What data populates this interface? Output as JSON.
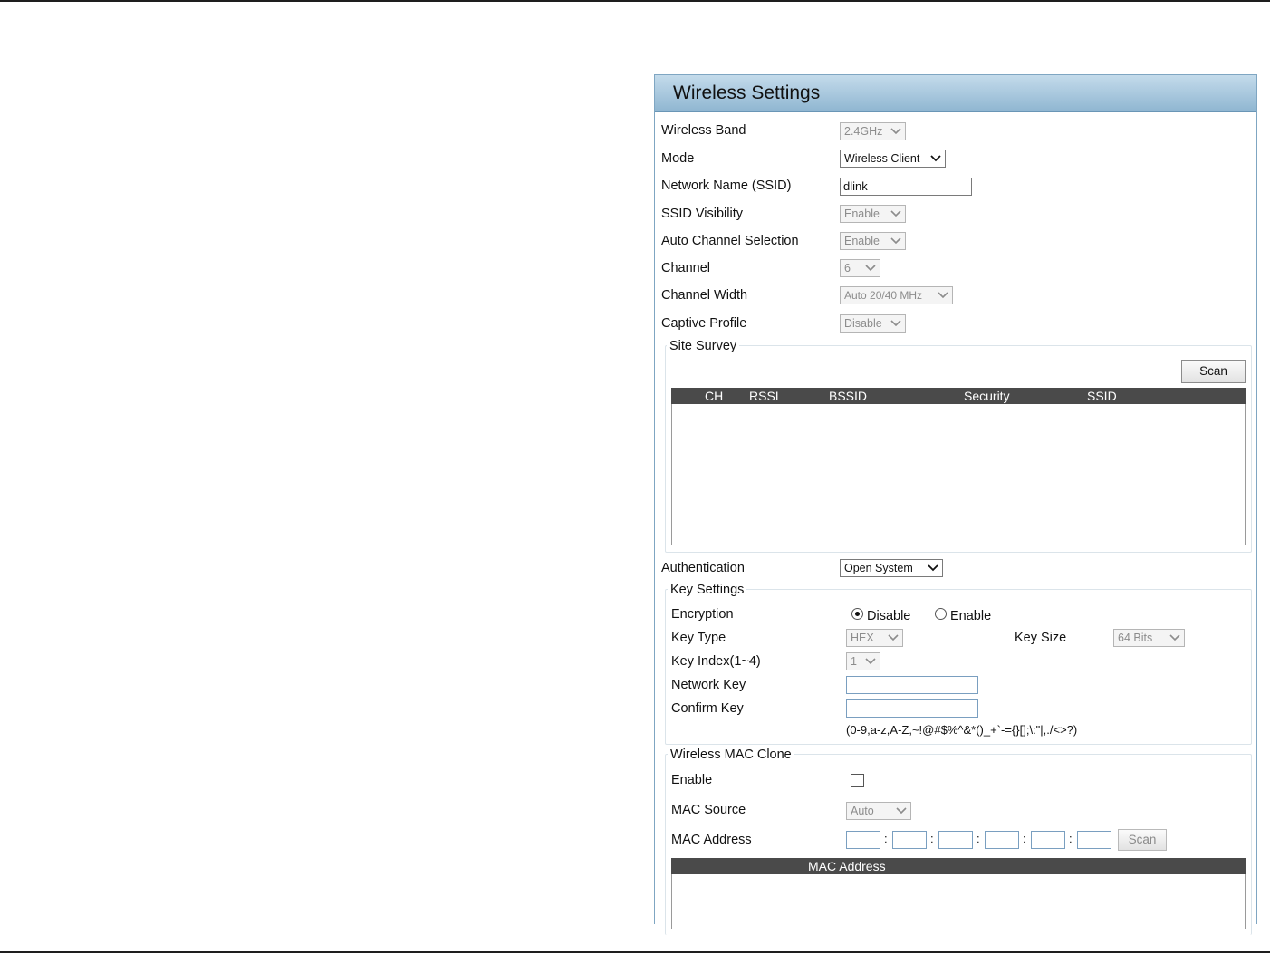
{
  "panel": {
    "title": "Wireless Settings"
  },
  "fields": {
    "wireless_band": {
      "label": "Wireless Band",
      "value": "2.4GHz"
    },
    "mode": {
      "label": "Mode",
      "value": "Wireless Client"
    },
    "ssid": {
      "label": "Network Name (SSID)",
      "value": "dlink"
    },
    "ssid_visibility": {
      "label": "SSID Visibility",
      "value": "Enable"
    },
    "auto_channel": {
      "label": "Auto Channel Selection",
      "value": "Enable"
    },
    "channel": {
      "label": "Channel",
      "value": "6"
    },
    "channel_width": {
      "label": "Channel Width",
      "value": "Auto 20/40 MHz"
    },
    "captive_profile": {
      "label": "Captive Profile",
      "value": "Disable"
    },
    "authentication": {
      "label": "Authentication",
      "value": "Open System"
    }
  },
  "site_survey": {
    "legend": "Site Survey",
    "scan_label": "Scan",
    "columns": [
      "CH",
      "RSSI",
      "BSSID",
      "Security",
      "SSID"
    ]
  },
  "key_settings": {
    "legend": "Key Settings",
    "encryption_label": "Encryption",
    "encryption_options": [
      "Disable",
      "Enable"
    ],
    "encryption_selected": "Disable",
    "key_type_label": "Key Type",
    "key_type_value": "HEX",
    "key_size_label": "Key Size",
    "key_size_value": "64 Bits",
    "key_index_label": "Key Index(1~4)",
    "key_index_value": "1",
    "network_key_label": "Network Key",
    "confirm_key_label": "Confirm Key",
    "allowed_chars": "(0-9,a-z,A-Z,~!@#$%^&*()_+`-={}[];\\:\"|,./<>?)"
  },
  "mac_clone": {
    "legend": "Wireless MAC Clone",
    "enable_label": "Enable",
    "enable_checked": false,
    "mac_source_label": "MAC Source",
    "mac_source_value": "Auto",
    "mac_address_label": "MAC Address",
    "scan_label": "Scan",
    "table_header": "MAC Address"
  }
}
